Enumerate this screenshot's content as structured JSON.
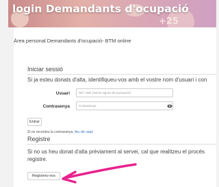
{
  "banner": {
    "title": "login Demandants d'ocupació",
    "deco_text": "+25"
  },
  "page": {
    "area_title": "Àrea personal Demandants d'ocupació- BTM online"
  },
  "login": {
    "heading": "Iniciar sessió",
    "intro": "Si ja esteu donats d'alta, identifiqueu-vos amb el vostre nom d'usuari i con",
    "user_label": "Usuari",
    "user_placeholder": "NIF / NIE (sense signes de puntuació)",
    "password_label": "Contrasenya",
    "password_placeholder": "Contrasenya",
    "submit_label": "Entrar",
    "forgot_text": "Si no recordeu la contrasenya, ",
    "forgot_link": "feu clic aquí"
  },
  "register": {
    "heading": "Registre",
    "intro_line1": "Si no us heu donat d'alta prèviament al servei, cal que realitzeu el procés",
    "intro_line2": "registre.",
    "button_label": "Registreu-vos"
  },
  "colors": {
    "arrow": "#e8228c",
    "link": "#2a6ebb"
  }
}
